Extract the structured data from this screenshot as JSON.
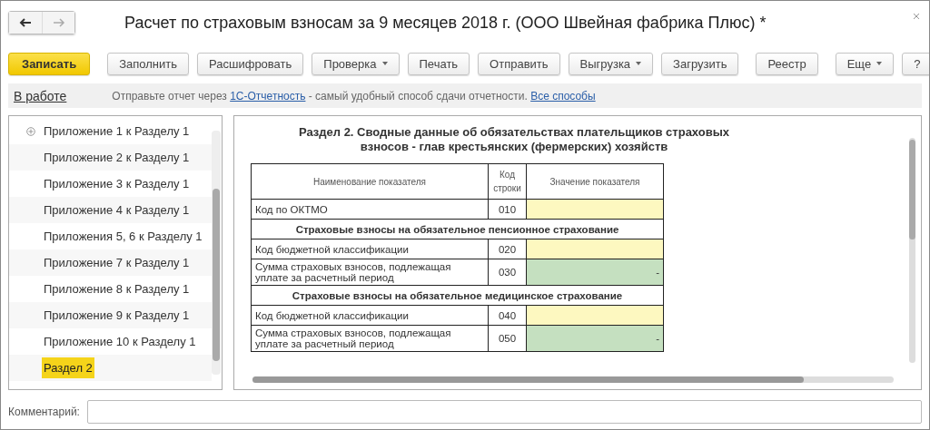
{
  "window": {
    "title": "Расчет по страховым взносам за 9 месяцев 2018 г. (ООО Швейная фабрика Плюс) *"
  },
  "toolbar": [
    {
      "label": "Записать",
      "primary": true,
      "dropdown": false
    },
    {
      "label": "Заполнить",
      "primary": false,
      "dropdown": false
    },
    {
      "label": "Расшифровать",
      "primary": false,
      "dropdown": false
    },
    {
      "label": "Проверка",
      "primary": false,
      "dropdown": true
    },
    {
      "label": "Печать",
      "primary": false,
      "dropdown": false
    },
    {
      "label": "Отправить",
      "primary": false,
      "dropdown": false
    },
    {
      "label": "Выгрузка",
      "primary": false,
      "dropdown": true
    },
    {
      "label": "Загрузить",
      "primary": false,
      "dropdown": false
    },
    {
      "label": "Реестр",
      "primary": false,
      "dropdown": false
    },
    {
      "label": "Еще",
      "primary": false,
      "dropdown": true
    },
    {
      "label": "?",
      "primary": false,
      "dropdown": false
    }
  ],
  "info_bar": {
    "status": "В работе",
    "text_before": "Отправьте отчет через",
    "link": "1С-Отчетность",
    "text_after": "- самый удобный способ сдачи отчетности.",
    "link2": "Все способы"
  },
  "sections": [
    {
      "label": "Приложение 1 к Разделу 1",
      "expandable": true,
      "selected": false
    },
    {
      "label": "Приложение 2 к Разделу 1",
      "expandable": false,
      "selected": false
    },
    {
      "label": "Приложение 3 к Разделу 1",
      "expandable": false,
      "selected": false
    },
    {
      "label": "Приложение 4 к Разделу 1",
      "expandable": false,
      "selected": false
    },
    {
      "label": "Приложения 5, 6 к Разделу 1",
      "expandable": false,
      "selected": false
    },
    {
      "label": "Приложение 7 к Разделу 1",
      "expandable": false,
      "selected": false
    },
    {
      "label": "Приложение 8 к Разделу 1",
      "expandable": false,
      "selected": false
    },
    {
      "label": "Приложение 9 к Разделу 1",
      "expandable": false,
      "selected": false
    },
    {
      "label": "Приложение 10 к Разделу 1",
      "expandable": false,
      "selected": false
    },
    {
      "label": "Раздел 2",
      "expandable": false,
      "selected": true
    }
  ],
  "form": {
    "title": "Раздел 2. Сводные данные об обязательствах плательщиков страховых взносов - глав крестьянских (фермерских) хозяйств",
    "columns": [
      "Наименование показателя",
      "Код строки",
      "Значение показателя"
    ],
    "rows": [
      {
        "kind": "field",
        "name": "Код по ОКТМО",
        "code": "010",
        "editable": true
      },
      {
        "kind": "section",
        "name": "Страховые взносы на обязательное пенсионное страхование"
      },
      {
        "kind": "field",
        "name": "Код бюджетной классификации",
        "code": "020",
        "editable": true
      },
      {
        "kind": "field",
        "name": "Сумма страховых взносов, подлежащая уплате за расчетный период",
        "code": "030",
        "editable": false,
        "value": "-"
      },
      {
        "kind": "section",
        "name": "Страховые взносы на обязательное медицинское страхование"
      },
      {
        "kind": "field",
        "name": "Код бюджетной классификации",
        "code": "040",
        "editable": true
      },
      {
        "kind": "field",
        "name": "Сумма страховых взносов, подлежащая уплате за расчетный период",
        "code": "050",
        "editable": false,
        "value": "-"
      }
    ]
  },
  "comment": {
    "label": "Комментарий:"
  }
}
